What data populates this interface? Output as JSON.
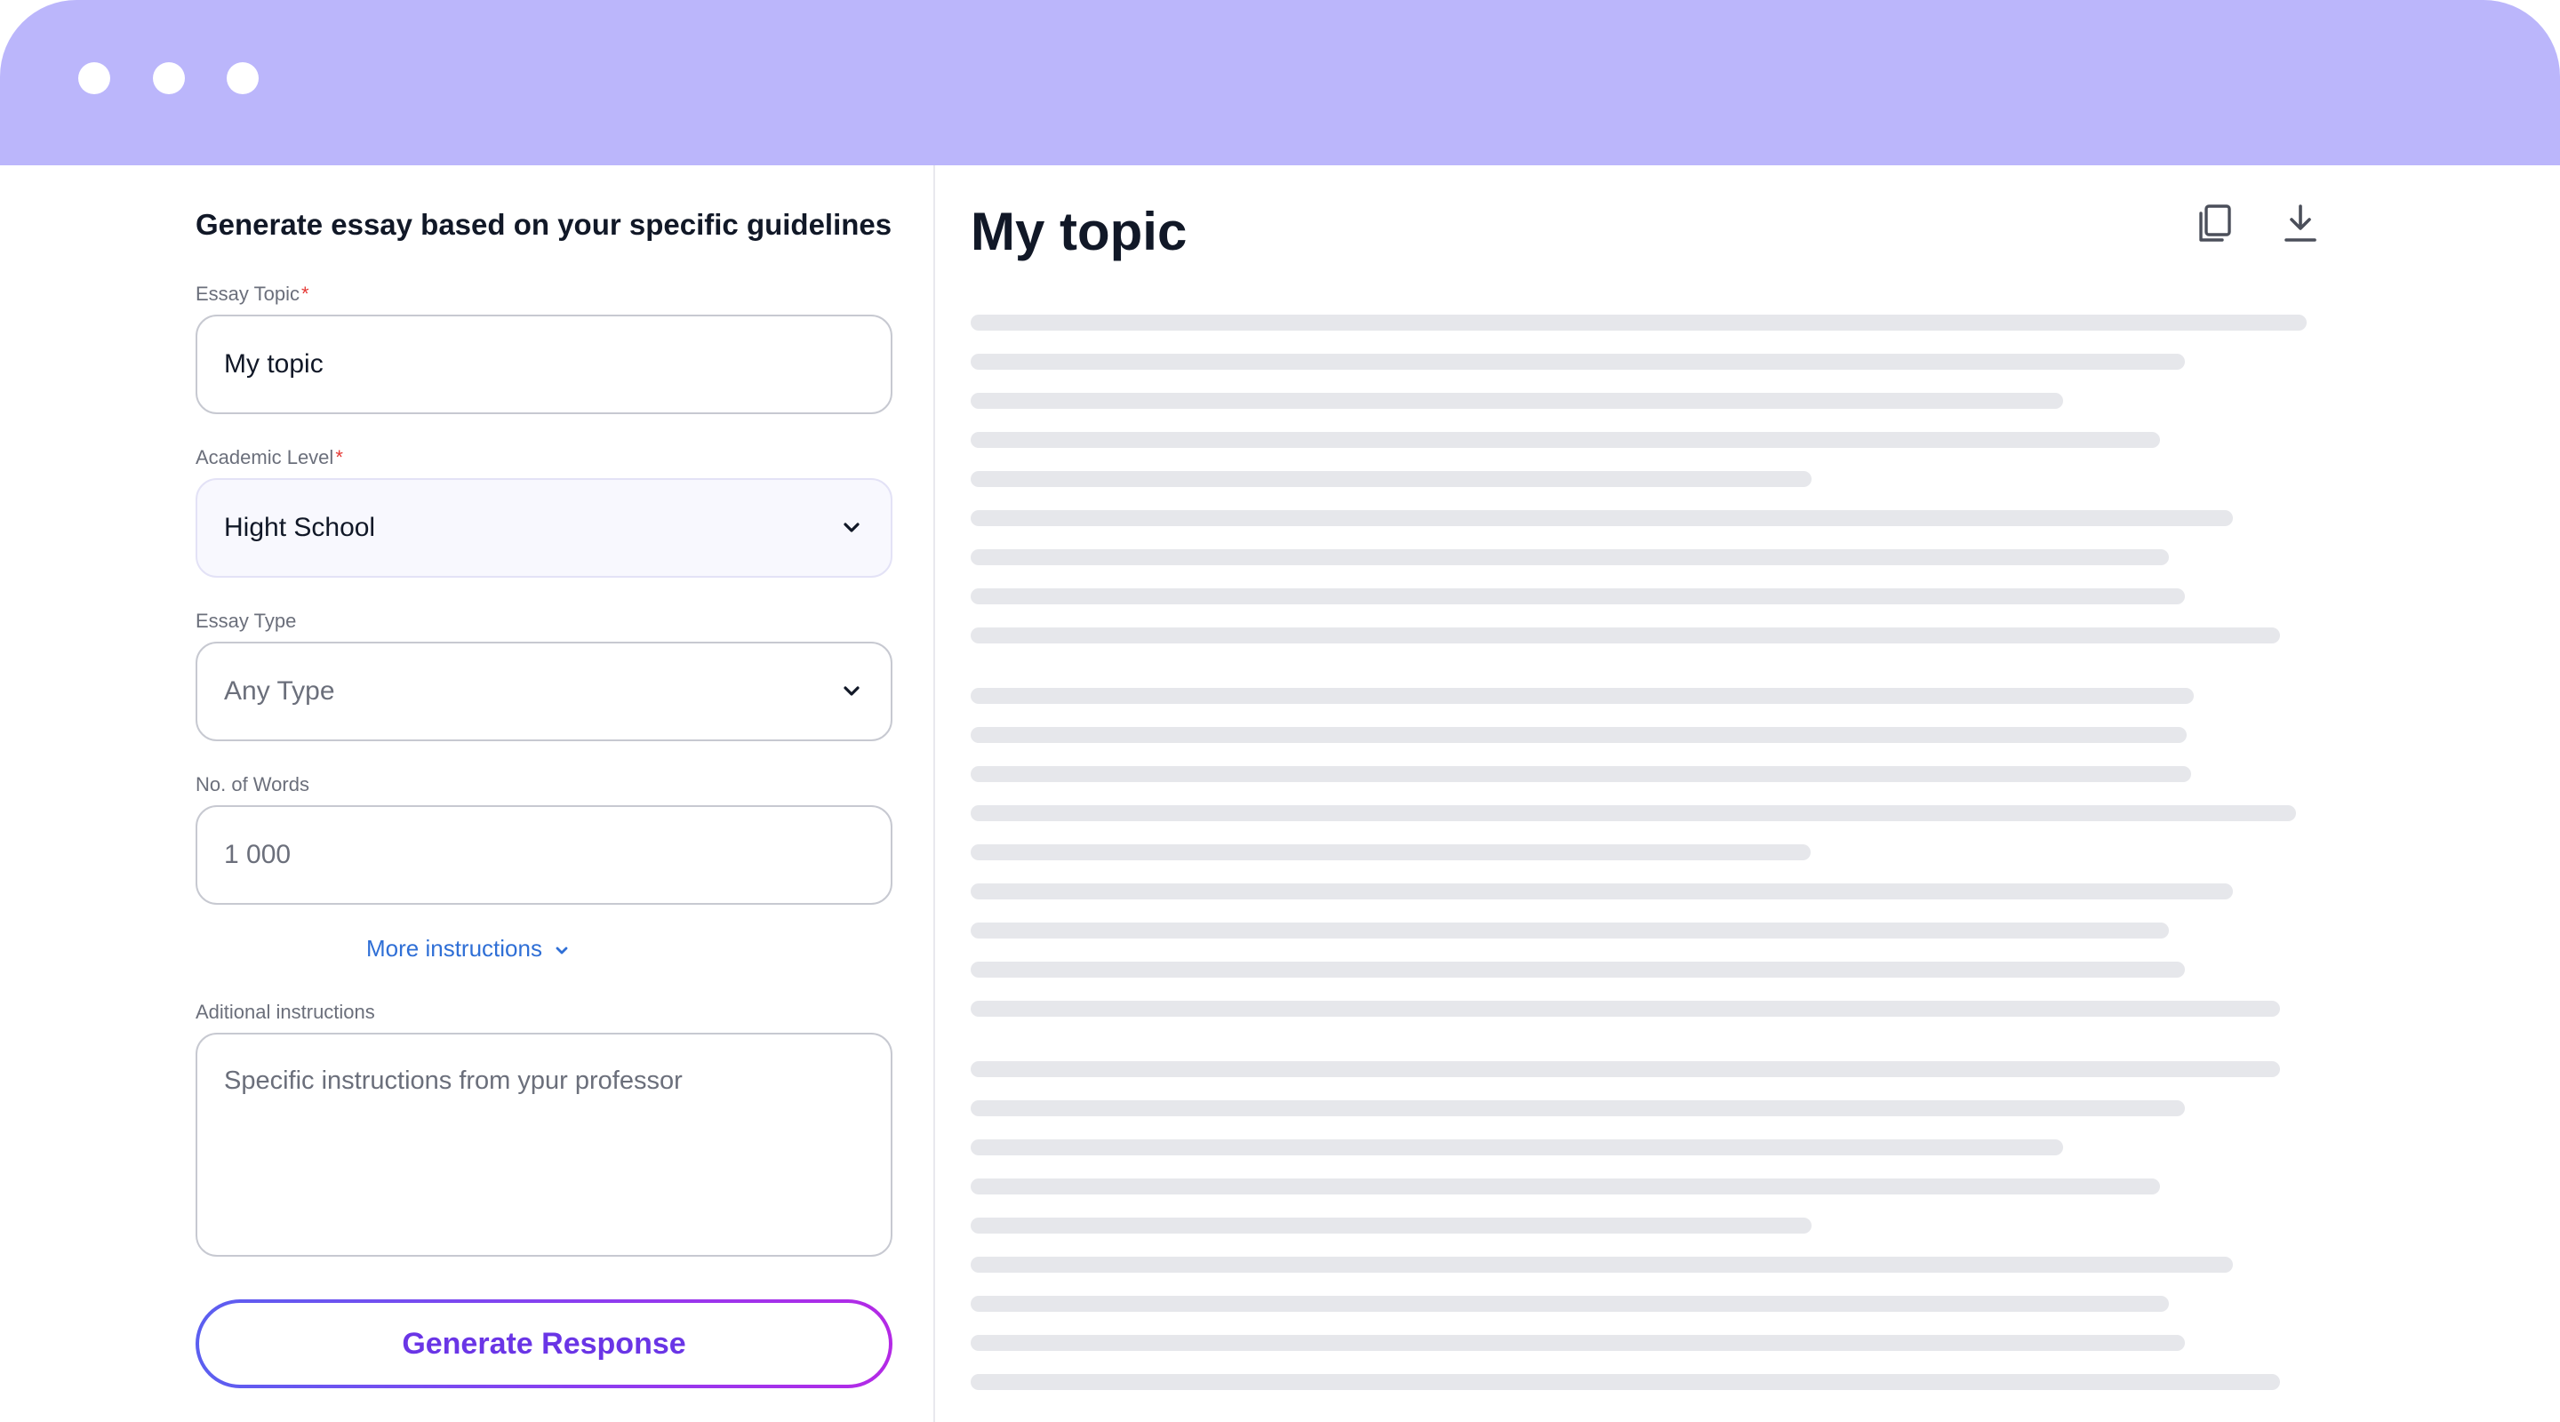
{
  "window": {
    "titlebar_color": "#bbb6fb",
    "traffic_dots": [
      "dot-1",
      "dot-2",
      "dot-3"
    ]
  },
  "form": {
    "title": "Generate essay based on your specific guidelines",
    "essay_topic": {
      "label": "Essay Topic",
      "required_mark": "*",
      "value": "My topic"
    },
    "academic_level": {
      "label": "Academic Level",
      "required_mark": "*",
      "value": "Hight School"
    },
    "essay_type": {
      "label": "Essay Type",
      "value": "Any Type"
    },
    "words": {
      "label": "No. of Words",
      "value": "1 000"
    },
    "more_instructions": "More instructions",
    "additional": {
      "label": "Aditional instructions",
      "placeholder": "Specific instructions from ypur professor"
    },
    "generate_button": "Generate Response"
  },
  "document": {
    "title": "My topic",
    "icons": [
      "copy-icon",
      "download-icon"
    ],
    "placeholder_text_lines": 27
  },
  "colors": {
    "accent": "#6a35e6",
    "link": "#2f6fd6",
    "skeleton": "#e6e7eb",
    "required": "#e53935"
  }
}
